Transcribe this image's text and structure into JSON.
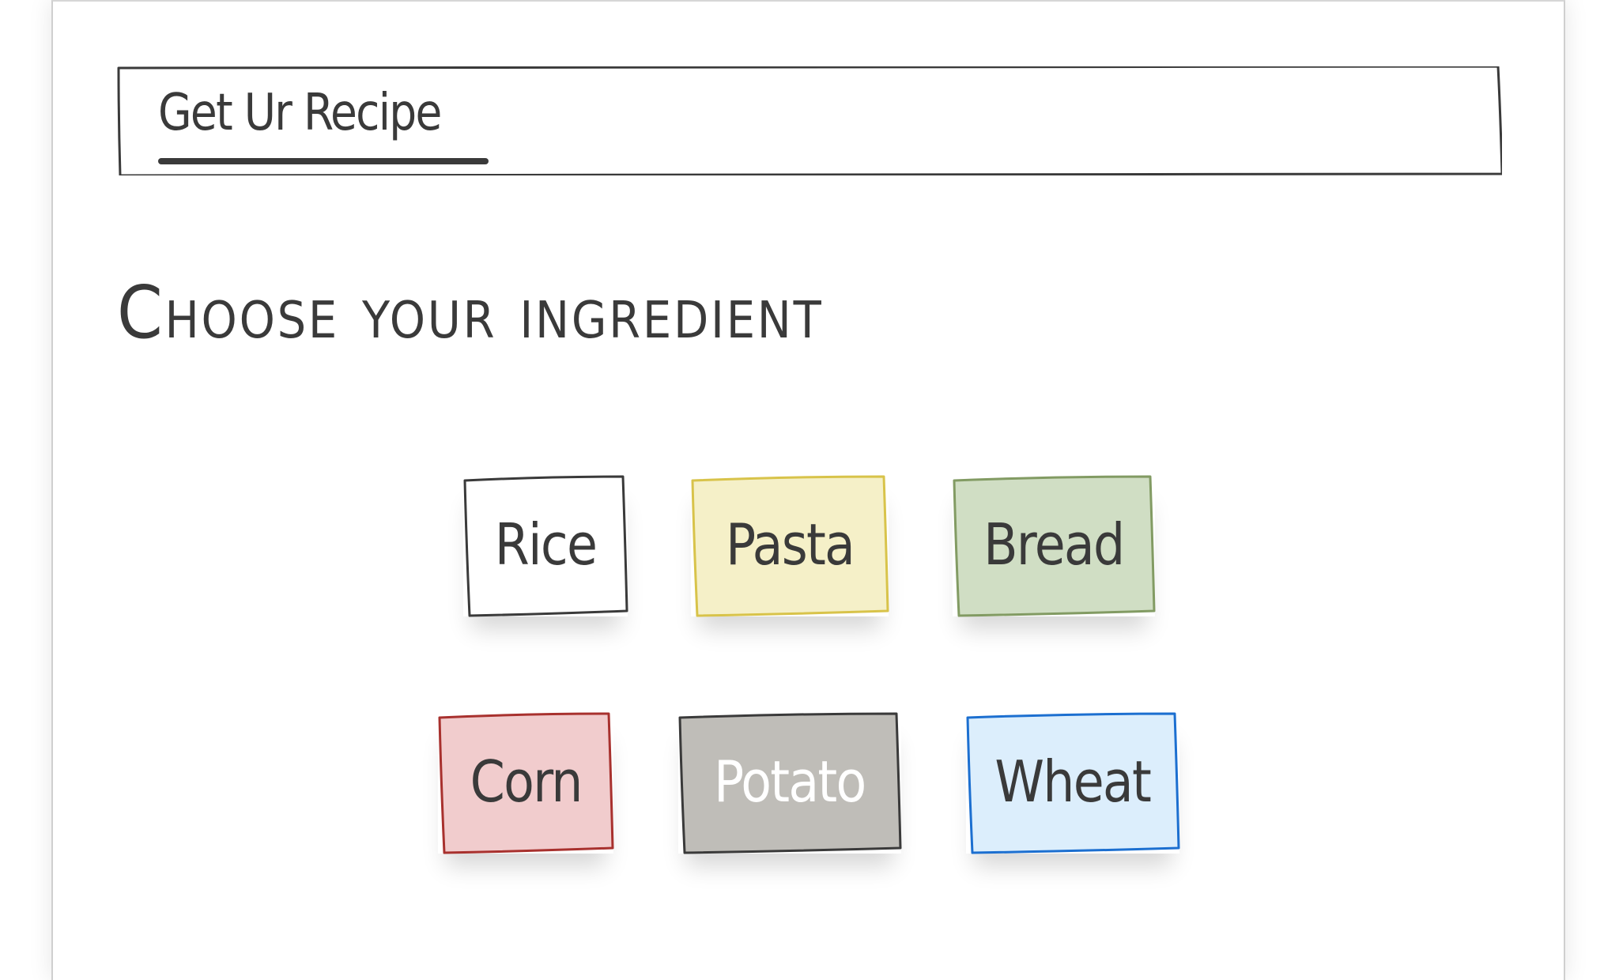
{
  "header": {
    "brand_label": "Get Ur Recipe",
    "border_color": "#3a3a3a"
  },
  "main": {
    "heading": "Choose your ingredient"
  },
  "ingredients": [
    {
      "label": "Rice",
      "fill": "#ffffff",
      "stroke": "#3a3a3a",
      "text_color": "#3a3a3a"
    },
    {
      "label": "Pasta",
      "fill": "#f5f0c8",
      "stroke": "#d8c34a",
      "text_color": "#3a3a3a"
    },
    {
      "label": "Bread",
      "fill": "#d0dec4",
      "stroke": "#829b63",
      "text_color": "#3a3a3a"
    },
    {
      "label": "Corn",
      "fill": "#f1cccd",
      "stroke": "#a8312e",
      "text_color": "#3a3a3a"
    },
    {
      "label": "Potato",
      "fill": "#bfbdb8",
      "stroke": "#3a3a3a",
      "text_color": "#ffffff"
    },
    {
      "label": "Wheat",
      "fill": "#dceefc",
      "stroke": "#1c6fd0",
      "text_color": "#3a3a3a"
    }
  ]
}
